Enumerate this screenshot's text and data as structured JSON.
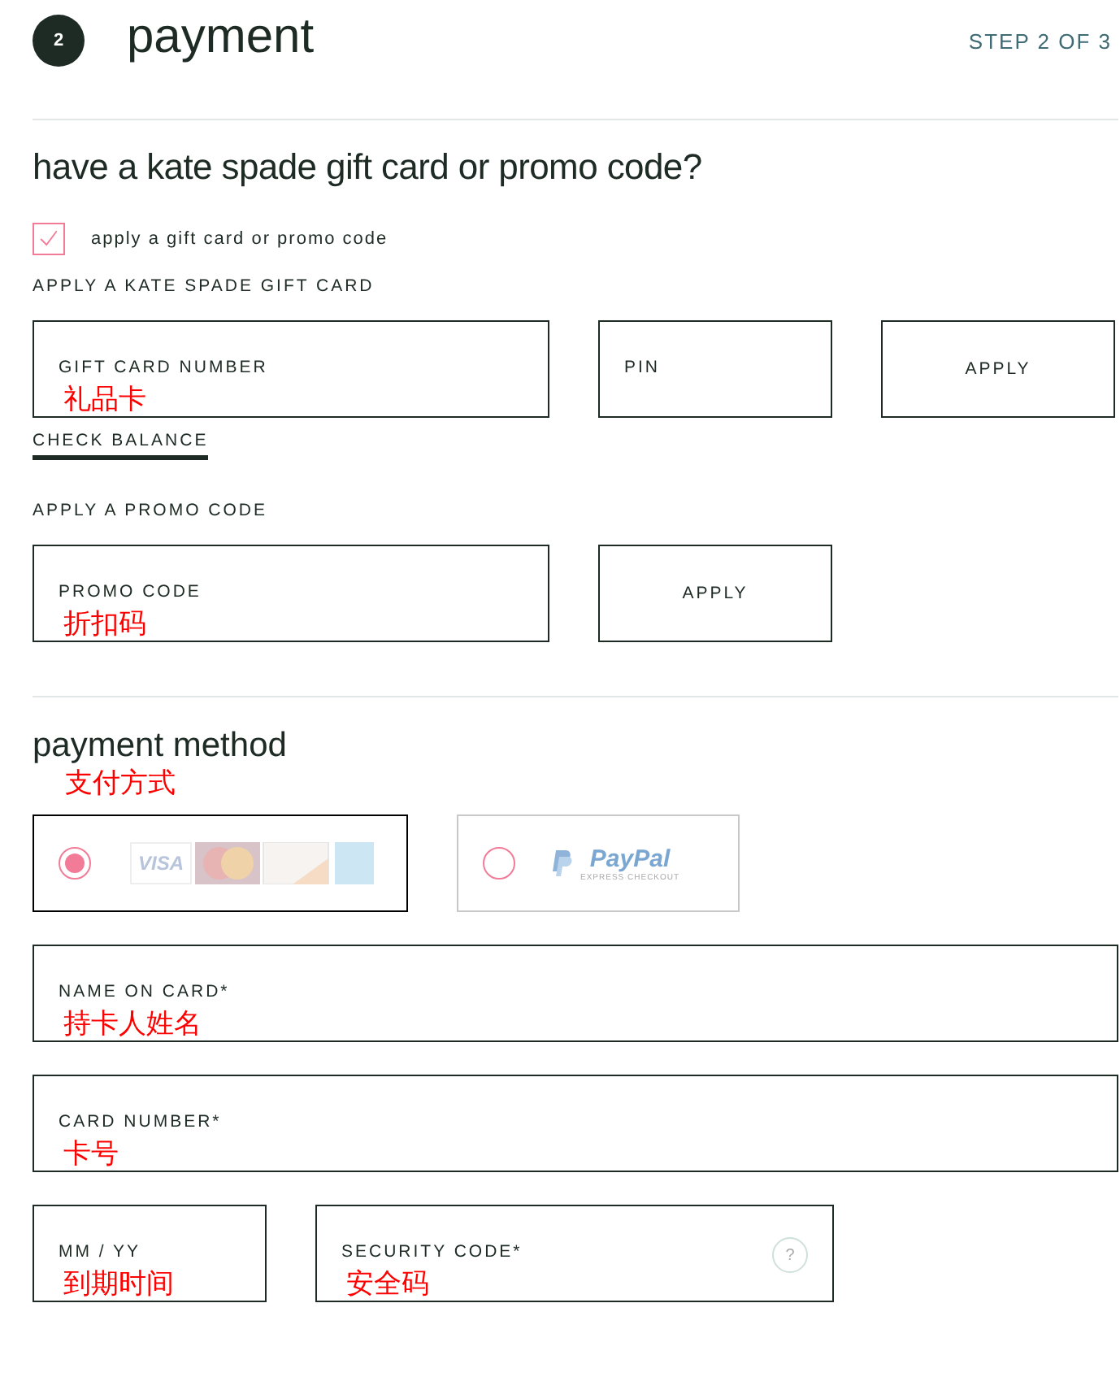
{
  "header": {
    "step_number": "2",
    "title": "payment",
    "step_text": "STEP 2 OF 3"
  },
  "promo": {
    "heading": "have a kate spade gift card or promo code?",
    "checkbox": {
      "label": "apply a gift card or promo code",
      "checked": true
    },
    "gift_card": {
      "label": "APPLY A KATE SPADE GIFT CARD",
      "number_field": {
        "placeholder": "GIFT CARD NUMBER",
        "annotation": "礼品卡"
      },
      "pin_field": {
        "placeholder": "PIN"
      },
      "apply_button": "APPLY",
      "check_balance_link": "CHECK BALANCE"
    },
    "promo_code": {
      "label": "APPLY A PROMO CODE",
      "code_field": {
        "placeholder": "PROMO CODE",
        "annotation": "折扣码"
      },
      "apply_button": "APPLY"
    }
  },
  "payment_method": {
    "heading": "payment method",
    "annotation": "支付方式",
    "options": [
      {
        "kind": "cards",
        "selected": true,
        "logo_text": "VISA"
      },
      {
        "kind": "paypal",
        "selected": false,
        "logo_text": "PayPal",
        "logo_subtext": "EXPRESS CHECKOUT"
      }
    ],
    "field_rows": [
      [
        {
          "placeholder": "NAME ON CARD*",
          "annotation": "持卡人姓名"
        }
      ],
      [
        {
          "placeholder": "CARD NUMBER*",
          "annotation": "卡号"
        }
      ],
      [
        {
          "placeholder": "MM / YY",
          "annotation": "到期时间"
        },
        {
          "placeholder": "SECURITY CODE*",
          "annotation": "安全码",
          "help": "?"
        }
      ]
    ]
  }
}
